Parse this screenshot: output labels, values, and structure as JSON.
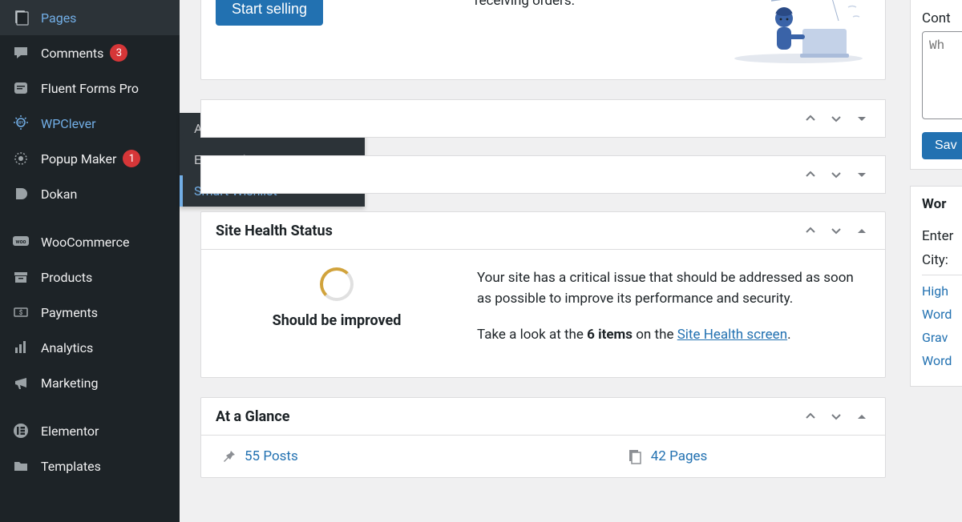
{
  "sidebar": {
    "items": [
      {
        "id": "pages",
        "label": "Pages",
        "icon": "page-icon"
      },
      {
        "id": "comments",
        "label": "Comments",
        "icon": "comment-icon",
        "badge": "3"
      },
      {
        "id": "fluentforms",
        "label": "Fluent Forms Pro",
        "icon": "form-icon"
      },
      {
        "id": "wpclever",
        "label": "WPClever",
        "icon": "lightbulb-icon",
        "active": true
      },
      {
        "id": "popupmaker",
        "label": "Popup Maker",
        "icon": "popup-icon",
        "badge": "1"
      },
      {
        "id": "dokan",
        "label": "Dokan",
        "icon": "dokan-icon"
      },
      {
        "id": "woocommerce",
        "label": "WooCommerce",
        "icon": "woo-icon"
      },
      {
        "id": "products",
        "label": "Products",
        "icon": "archive-icon"
      },
      {
        "id": "payments",
        "label": "Payments",
        "icon": "money-icon"
      },
      {
        "id": "analytics",
        "label": "Analytics",
        "icon": "chart-icon"
      },
      {
        "id": "marketing",
        "label": "Marketing",
        "icon": "megaphone-icon"
      },
      {
        "id": "elementor",
        "label": "Elementor",
        "icon": "elementor-icon"
      },
      {
        "id": "templates",
        "label": "Templates",
        "icon": "folder-icon"
      }
    ]
  },
  "flyout": {
    "items": [
      {
        "label": "About"
      },
      {
        "label": "Essential Kit"
      },
      {
        "label": "Smart Wishlist",
        "active": true
      }
    ]
  },
  "topcard": {
    "text": "receiving orders.",
    "button": "Start selling"
  },
  "collapsed_boxes": [
    {
      "title": ""
    },
    {
      "title": ""
    }
  ],
  "sitehealth": {
    "title": "Site Health Status",
    "status_label": "Should be improved",
    "p1": "Your site has a critical issue that should be addressed as soon as possible to improve its performance and security.",
    "p2_pre": "Take a look at the ",
    "p2_bold": "6 items",
    "p2_mid": " on the ",
    "p2_link": "Site Health screen",
    "p2_post": "."
  },
  "glance": {
    "title": "At a Glance",
    "posts": "55 Posts",
    "pages": "42 Pages"
  },
  "rightcol": {
    "content_label": "Cont",
    "textarea_placeholder": "Wh",
    "save": "Sav",
    "events_heading": "Wor",
    "city_pre": "Enter",
    "city_label": "City:",
    "links": [
      "High",
      "Word",
      "Grav",
      "Word"
    ]
  }
}
